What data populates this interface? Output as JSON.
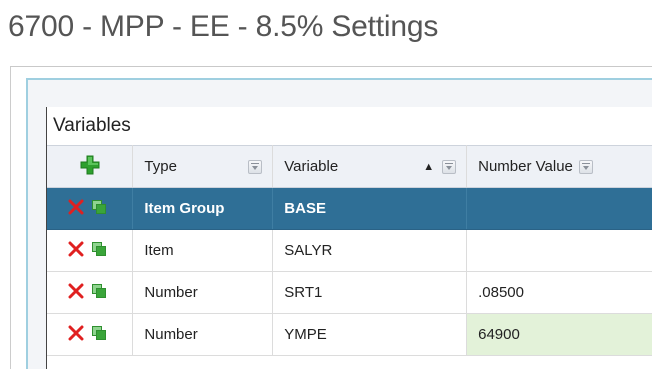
{
  "page": {
    "title": "6700 - MPP - EE - 8.5% Settings"
  },
  "panel": {
    "title": "Variables"
  },
  "grid": {
    "columns": [
      {
        "key": "type",
        "label": "Type",
        "sorted": ""
      },
      {
        "key": "variable",
        "label": "Variable",
        "sorted": "ascending"
      },
      {
        "key": "number_value",
        "label": "Number Value",
        "sorted": ""
      }
    ],
    "add_icon": "plus-icon",
    "sort_indicator": "▲",
    "rows": [
      {
        "type": "Item Group",
        "variable": "BASE",
        "number_value": "",
        "selected": true,
        "number_highlight": false
      },
      {
        "type": "Item",
        "variable": "SALYR",
        "number_value": "",
        "selected": false,
        "number_highlight": false
      },
      {
        "type": "Number",
        "variable": "SRT1",
        "number_value": ".08500",
        "selected": false,
        "number_highlight": false
      },
      {
        "type": "Number",
        "variable": "YMPE",
        "number_value": "64900",
        "selected": false,
        "number_highlight": true
      }
    ]
  },
  "colors": {
    "selected_row": "#2f6f96",
    "delete_icon": "#e02020",
    "copy_icon": "#3aa53a",
    "add_icon": "#2ea02e",
    "highlight_cell": "#e3f2d9"
  }
}
